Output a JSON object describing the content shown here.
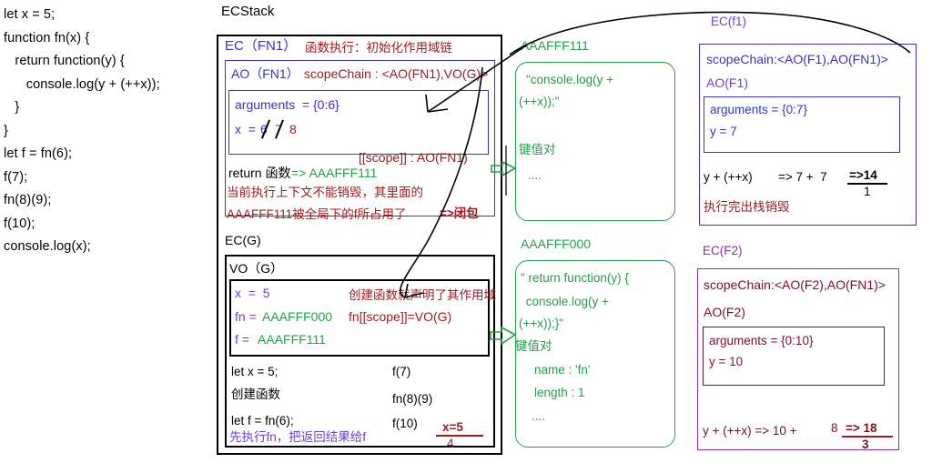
{
  "code_listing": {
    "lines": [
      "let x = 5;",
      "function fn(x) {",
      "   return function(y) {",
      "      console.log(y + (++x));",
      "   }",
      "}",
      "let f = fn(6);",
      "f(7);",
      "fn(8)(9);",
      "f(10);",
      "console.log(x);"
    ]
  },
  "ecstack": {
    "title": "ECStack",
    "fn1": {
      "label": "EC（FN1）",
      "note": "函数执行：初始化作用域链",
      "ao_label": "AO（FN1）",
      "scope_chain": "scopeChain : <AO(FN1),VO(G)>",
      "arguments": "arguments  = {0:6}",
      "x_name": "x  =",
      "x_v1": "6",
      "x_v2": "7",
      "x_v3": "8",
      "scope_prop": "[[scope]] : AO(FN1)",
      "return_label": "return 函数",
      "return_arrow": "=> AAAFFF111",
      "note2": "当前执行上下文不能销毁，其里面的",
      "note3": "AAAFFF111被全局下的f所占用了",
      "closure": "=>闭包"
    },
    "g": {
      "label": "EC(G)",
      "vo_label": "VO（G）",
      "x": "x  =  5",
      "fn_name": "fn =",
      "fn_val": "AAAFFF000",
      "fn_scope": "fn[[scope]]=VO(G)",
      "f_name": "f =",
      "f_val": "AAAFFF111",
      "create_note": "创建函数就声明了其作用域",
      "steps_left": [
        "let x = 5;",
        "创建函数",
        "let f = fn(6);"
      ],
      "steps_left_sub": "先执行fn，把返回结果给f",
      "steps_right": [
        "f(7)",
        "fn(8)(9)",
        "f(10)"
      ],
      "result_top": "x=5",
      "result_bottom": "4"
    }
  },
  "heap": {
    "aaafff111": {
      "label": "AAAFFF111",
      "body_lines": [
        "\"console.log(y +",
        "(++x));\""
      ],
      "kv_label": "键值对",
      "ellipsis": "...."
    },
    "aaafff000": {
      "label": "AAAFFF000",
      "body_lines": [
        "\" return function(y) {",
        " console.log(y +",
        "(++x));}\""
      ],
      "kv_label": "键值对",
      "kv_items": [
        "name : 'fn'",
        "length : 1"
      ],
      "ellipsis": "...."
    }
  },
  "ec_f1": {
    "label": "EC(f1)",
    "scope_chain": "scopeChain:<AO(F1),AO(FN1)>",
    "ao_label": "AO(F1)",
    "arguments": "arguments = {0:7}",
    "y": "y = 7",
    "expr": "y + (++x)",
    "arrow": "=> 7 +  7",
    "result": "=>14",
    "order": "1",
    "destroy_note": "执行完出栈销毁"
  },
  "ec_f2": {
    "label": "EC(F2)",
    "scope_chain": "scopeChain:<AO(F2),AO(FN1)>",
    "ao_label": "AO(F2)",
    "arguments": "arguments = {0:10}",
    "y": "y = 10",
    "expr": "y + (++x) => 10 +",
    "expr_operand": "8",
    "result": "=> 18",
    "order": "3"
  },
  "colors": {
    "blue": "#3333cc",
    "violet": "#6f3fd6",
    "dark_red": "#a01b20",
    "green": "#22a04a",
    "purple": "#8b2fa0",
    "maroon": "#7b1020",
    "black": "#000000",
    "red": "#cc1111"
  }
}
